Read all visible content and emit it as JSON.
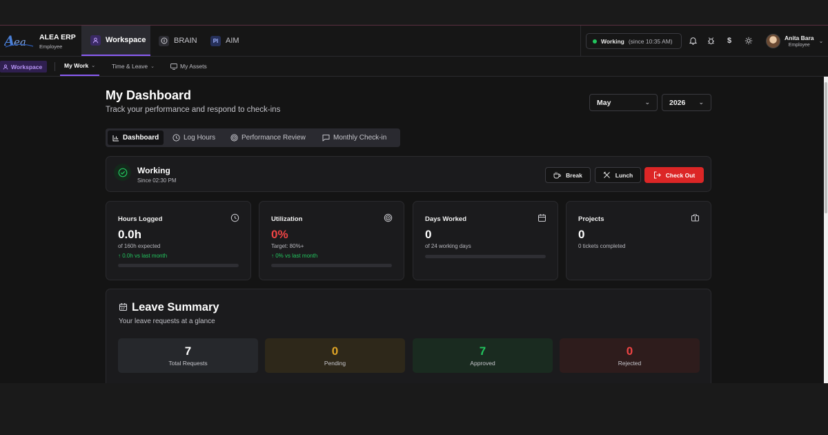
{
  "header": {
    "brand_name": "ALEA ERP",
    "brand_role": "Employee",
    "modules": [
      {
        "label": "Workspace",
        "icon": "user-icon"
      },
      {
        "label": "BRAIN",
        "icon": "info-circle-icon"
      },
      {
        "label": "AIM",
        "icon": "pi-badge-icon"
      }
    ],
    "status_label": "Working",
    "status_since": "(since 10:35 AM)",
    "user_name": "Anita Bara",
    "user_role": "Employee"
  },
  "subnav": {
    "workspace_chip": "Workspace",
    "items": [
      {
        "label": "My Work"
      },
      {
        "label": "Time & Leave"
      },
      {
        "label": "My Assets"
      }
    ]
  },
  "page": {
    "title": "My Dashboard",
    "subtitle": "Track your performance and respond to check-ins",
    "month": "May",
    "year": "2026"
  },
  "tabs": [
    {
      "label": "Dashboard",
      "icon": "bar-chart-icon"
    },
    {
      "label": "Log Hours",
      "icon": "clock-icon"
    },
    {
      "label": "Performance Review",
      "icon": "target-icon"
    },
    {
      "label": "Monthly Check-in",
      "icon": "chat-icon"
    }
  ],
  "status_card": {
    "title": "Working",
    "since": "Since 02:30 PM",
    "break_label": "Break",
    "lunch_label": "Lunch",
    "checkout_label": "Check Out"
  },
  "stats": [
    {
      "label": "Hours Logged",
      "value": "0.0h",
      "sub": "of 160h expected",
      "trend": "0.0h vs last month",
      "progress": 0
    },
    {
      "label": "Utilization",
      "value": "0%",
      "sub": "Target: 80%+",
      "trend": "0% vs last month",
      "progress": 0
    },
    {
      "label": "Days Worked",
      "value": "0",
      "sub": "of 24 working days",
      "progress": 0
    },
    {
      "label": "Projects",
      "value": "0",
      "sub": "0 tickets completed"
    }
  ],
  "leave": {
    "title": "Leave Summary",
    "subtitle": "Your leave requests at a glance",
    "boxes": [
      {
        "value": "7",
        "label": "Total Requests",
        "color": "#ffffff",
        "bg": "#26282c"
      },
      {
        "value": "0",
        "label": "Pending",
        "color": "#e0a526",
        "bg": "#2e281a"
      },
      {
        "value": "7",
        "label": "Approved",
        "color": "#22c55e",
        "bg": "#1a2b20"
      },
      {
        "value": "0",
        "label": "Rejected",
        "color": "#ef4444",
        "bg": "#2e1c1c"
      }
    ]
  },
  "colors": {
    "accent": "#8b5cf6",
    "success": "#22c55e",
    "danger": "#dc2626"
  }
}
